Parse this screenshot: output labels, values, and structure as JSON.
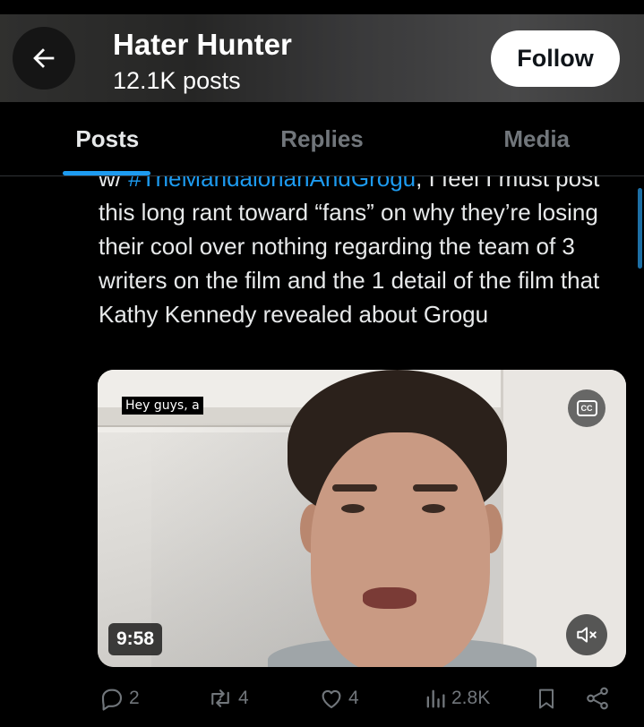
{
  "header": {
    "name": "Hater Hunter",
    "post_count": "12.1K posts",
    "follow_label": "Follow",
    "back_icon": "arrow-left-icon"
  },
  "tabs": [
    {
      "label": "Posts",
      "active": true
    },
    {
      "label": "Replies",
      "active": false
    },
    {
      "label": "Media",
      "active": false
    }
  ],
  "post": {
    "text_prefix": "w/ ",
    "hashtag": "#TheMandalorianAndGrogu",
    "text_body": ", I feel I must post this long rant toward “fans” on why they’re losing their cool over nothing regarding the team of 3 writers on the film and the 1 detail of the film that Kathy Kennedy revealed about Grogu",
    "video": {
      "caption": "Hey guys, a",
      "cc_label": "CC",
      "duration": "9:58",
      "muted": true
    },
    "stats": {
      "replies": "2",
      "reposts": "4",
      "likes": "4",
      "views": "2.8K"
    }
  },
  "colors": {
    "accent": "#1d9bf0",
    "text_primary": "#e7e9ea",
    "text_secondary": "#71767b",
    "background": "#000000"
  }
}
